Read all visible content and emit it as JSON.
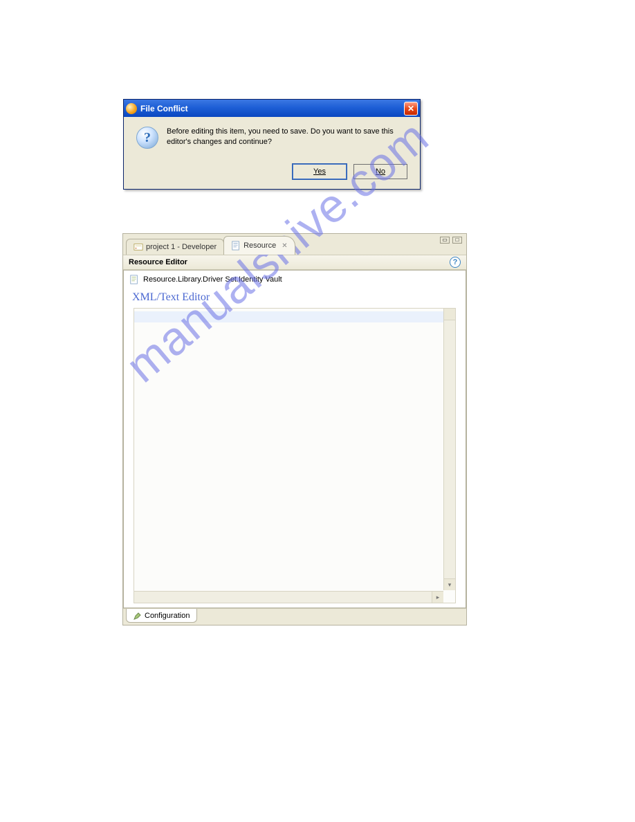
{
  "dialog": {
    "title": "File Conflict",
    "message": "Before editing this item, you need to save.  Do you want to save this editor's changes and continue?",
    "yes": "Yes",
    "no": "No"
  },
  "editor": {
    "tabs": {
      "tab1": "project 1 - Developer",
      "tab2": "Resource"
    },
    "heading": "Resource Editor",
    "resource_path": "Resource.Library.Driver Set.Identity Vault",
    "section_title": "XML/Text Editor",
    "bottom_tab": "Configuration"
  },
  "watermark": "manualshive.com"
}
